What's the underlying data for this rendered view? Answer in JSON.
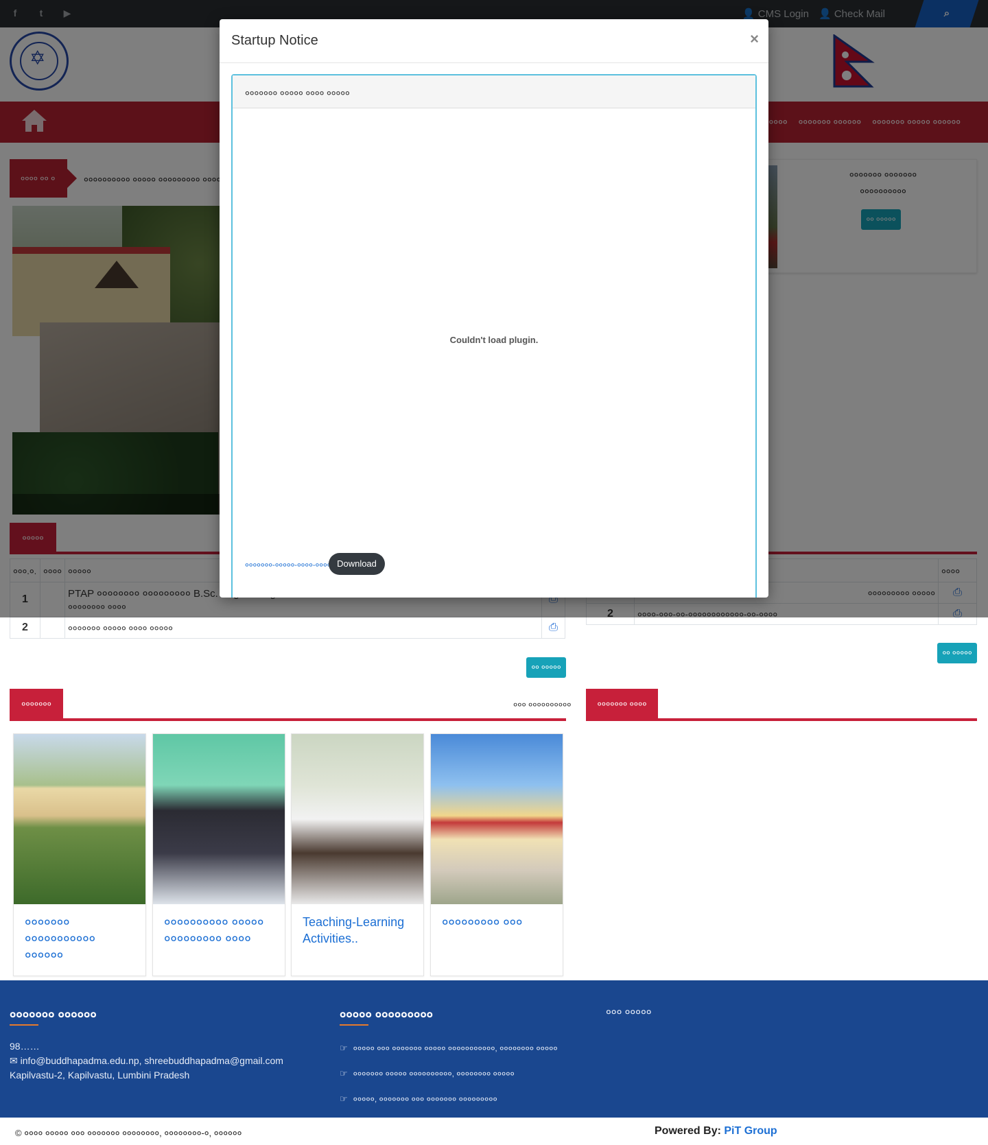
{
  "topbar": {
    "cms_login": "CMS Login",
    "check_mail": "Check Mail",
    "search_icon": "search-icon"
  },
  "nav": {
    "items": [
      "००००००",
      "००००००० ००००००",
      "००००००० ००००० ००००००"
    ]
  },
  "ticker": {
    "label": "०००० ०० ०",
    "text": "०००००००००० ००००० ००००००००० ०००००"
  },
  "info_card": {
    "title_line1": "००००००० ०००००००",
    "title_line2": "००००००००००",
    "button": "०० ०००००"
  },
  "notices": {
    "tab": "०००००",
    "columns": [
      "०००.०.",
      "००००",
      "०००००"
    ],
    "rows": [
      {
        "num": "1",
        "date": "",
        "title": "PTAP ०००००००० ००००००००० B.Sc. Engineering",
        "title2": "०००००००० ००००"
      },
      {
        "num": "2",
        "date": "",
        "title": "००००००० ००००० ०००० ०००००",
        "title2": ""
      }
    ],
    "view_all": "०० ०००००"
  },
  "right_table": {
    "col_last": "००००",
    "rows": [
      {
        "num": "",
        "title": "००००००००० ०००००"
      },
      {
        "num": "2",
        "title": "००००-०००-००-००००००००००००-००-००००"
      }
    ],
    "view_all": "०० ०००००"
  },
  "gallery": {
    "tab": "०००००००",
    "view_all": "००० ००००००००००",
    "cards": [
      {
        "caption": "००००००० ००००००००००० ००००००"
      },
      {
        "caption": "०००००००००० ००००० ००००००००० ००००"
      },
      {
        "caption": "Teaching-Learning Activities.."
      },
      {
        "caption": "००००००००० ०००"
      }
    ]
  },
  "right_section": {
    "tab": "००००००० ००००"
  },
  "footer": {
    "contact_title": "००००००० ००००००",
    "phone": "98……",
    "email": "info@buddhapadma.edu.np, shreebuddhapadma@gmail.com",
    "address": "Kapilvastu-2, Kapilvastu, Lumbini Pradesh",
    "links_title": "००००० ०००००००००",
    "links": [
      "००००० ००० ००००००० ००००० ०००००००००००, ०००००००० ०००००",
      "००००००० ००००० ००००००००००, ०००००००० ०००००",
      "०००००, ००००००० ००० ००००००० ०००००००००"
    ],
    "third_title": "००० ०००००"
  },
  "copyright": {
    "text": "© ०००० ००००० ००० ००००००० ००००००००, ००००००००-०, ००००००",
    "powered_label": "Powered By: ",
    "powered_brand": "PiT Group"
  },
  "modal": {
    "title": "Startup Notice",
    "close": "×",
    "panel_title": "००००००० ००००० ०००० ०००००",
    "plugin_msg": "Couldn't load plugin.",
    "file_link": "०००००००-०००००-००००-०००००",
    "download": "Download"
  }
}
